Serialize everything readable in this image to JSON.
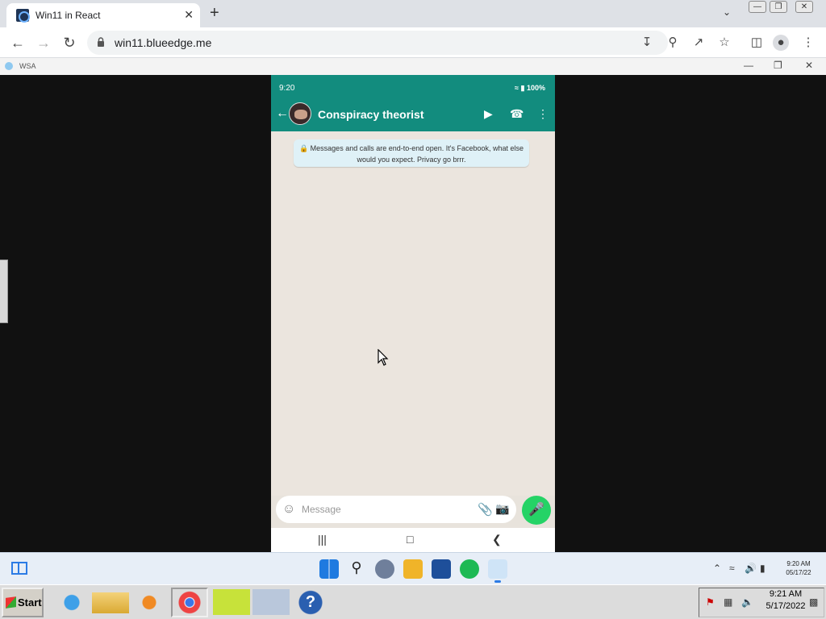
{
  "browser": {
    "tab_title": "Win11 in React",
    "url": "win11.blueedge.me",
    "new_tab": "+",
    "tab_close": "✕"
  },
  "wsa": {
    "title": "WSA"
  },
  "phone": {
    "status_time": "9:20",
    "status_battery": "100%",
    "contact_name": "Conspiracy theorist",
    "e2e_notice": "Messages and calls are end-to-end open. It's Facebook, what else would you expect. Privacy go brrr.",
    "message_placeholder": "Message"
  },
  "win11_taskbar": {
    "clock_time": "9:20 AM",
    "clock_date": "05/17/22"
  },
  "xp_taskbar": {
    "start_label": "Start",
    "clock_time": "9:21 AM",
    "clock_date": "5/17/2022"
  },
  "colors": {
    "whatsapp_teal": "#128c7e",
    "whatsapp_green": "#25d366",
    "chat_bg": "#ebe5de",
    "e2e_bg": "#dff1f7"
  }
}
